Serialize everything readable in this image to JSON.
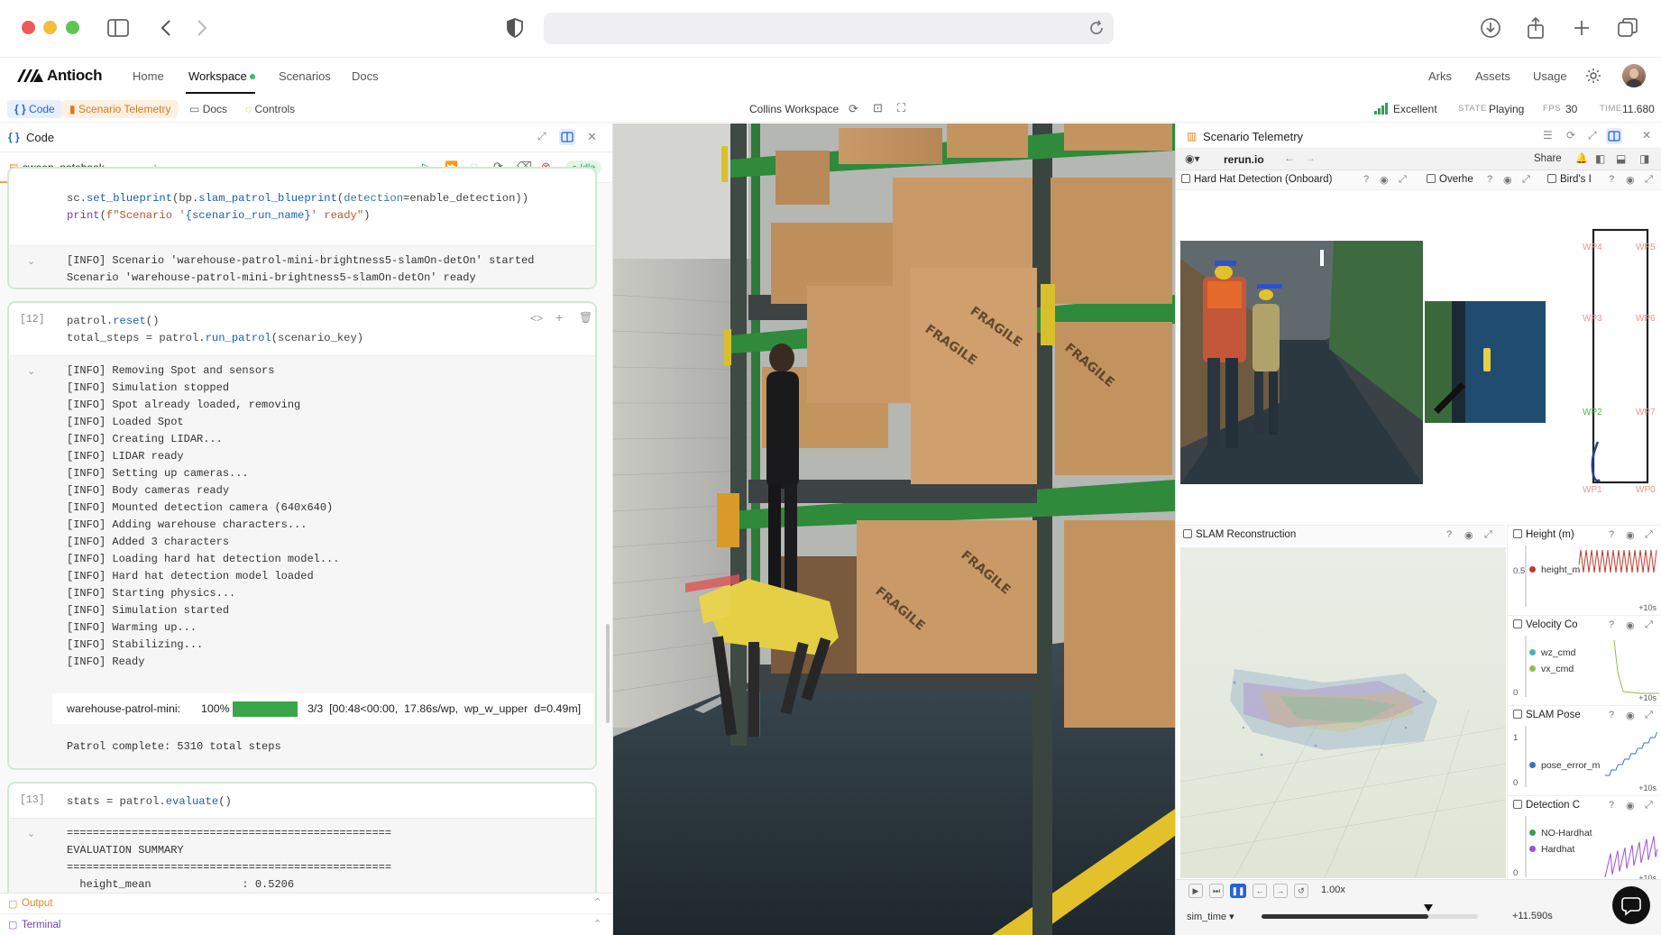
{
  "app": {
    "brand": "Antioch",
    "nav": [
      "Home",
      "Workspace",
      "Scenarios",
      "Docs"
    ],
    "nav_right": [
      "Arks",
      "Assets",
      "Usage"
    ]
  },
  "toolbar": {
    "tabs": [
      "Code",
      "Scenario Telemetry",
      "Docs",
      "Controls"
    ],
    "workspace_name": "Collins Workspace",
    "quality": "Excellent",
    "state_label": "STATE",
    "state_value": "Playing",
    "fps_label": "FPS",
    "fps_value": "30",
    "time_label": "TIME",
    "time_value": "11.680"
  },
  "code_panel": {
    "title": "Code",
    "file_tab": "sweep_notebook....",
    "kernel_status": "Idle",
    "cell_a": {
      "lines": [
        "sc.set_blueprint(bp.slam_patrol_blueprint(detection=enable_detection))",
        "print(f\"Scenario '{scenario_run_name}' ready\")"
      ],
      "output": [
        "[INFO] Scenario 'warehouse-patrol-mini-brightness5-slamOn-detOn' started",
        "Scenario 'warehouse-patrol-mini-brightness5-slamOn-detOn' ready"
      ]
    },
    "cell_12": {
      "number": "[12]",
      "lines": [
        "patrol.reset()",
        "total_steps = patrol.run_patrol(scenario_key)"
      ],
      "output": [
        "[INFO] Removing Spot and sensors",
        "[INFO] Simulation stopped",
        "[INFO] Spot already loaded, removing",
        "[INFO] Loaded Spot",
        "[INFO] Creating LIDAR...",
        "[INFO] LIDAR ready",
        "[INFO] Setting up cameras...",
        "[INFO] Body cameras ready",
        "[INFO] Mounted detection camera (640x640)",
        "[INFO] Adding warehouse characters...",
        "[INFO] Added 3 characters",
        "[INFO] Loading hard hat detection model...",
        "[INFO] Hard hat detection model loaded",
        "[INFO] Starting physics...",
        "[INFO] Simulation started",
        "[INFO] Warming up...",
        "[INFO] Stabilizing...",
        "[INFO] Ready"
      ],
      "progress": {
        "name": "warehouse-patrol-mini:",
        "percent_text": "100%",
        "fraction": 1.0,
        "detail": "3/3  [00:48<00:00,  17.86s/wp,  wp_w_upper  d=0.49m]"
      },
      "complete": "Patrol complete: 5310 total steps"
    },
    "cell_13": {
      "number": "[13]",
      "lines": [
        "stats = patrol.evaluate()"
      ],
      "output": [
        "==================================================",
        "EVALUATION SUMMARY",
        "==================================================",
        "  height_mean              : 0.5206"
      ]
    },
    "bottom": [
      "Output",
      "Terminal"
    ]
  },
  "telemetry": {
    "title": "Scenario Telemetry",
    "source": "rerun.io",
    "share": "Share",
    "views": {
      "hardhat": "Hard Hat Detection (Onboard)",
      "overhead": "Overhe",
      "birds": "Bird's I",
      "slam": "SLAM Reconstruction"
    },
    "waypoints": [
      "WP4",
      "WP5",
      "WP3",
      "WP6",
      "WP2",
      "WP7",
      "WP1",
      "WP0"
    ],
    "plots": [
      {
        "title": "Height (m)",
        "y_tick": "0.5",
        "legend": [
          "height_m"
        ],
        "x_label": "+10s"
      },
      {
        "title": "Velocity Co",
        "y_tick": "0",
        "legend": [
          "wz_cmd",
          "vx_cmd"
        ],
        "x_label": "+10s"
      },
      {
        "title": "SLAM Pose",
        "y_tick_top": "1",
        "y_tick": "0",
        "legend": [
          "pose_error_m"
        ],
        "x_label": "+10s"
      },
      {
        "title": "Detection C",
        "y_tick": "0",
        "legend": [
          "NO-Hardhat",
          "Hardhat"
        ],
        "x_label": "+10s"
      }
    ],
    "playback": {
      "speed": "1.00x",
      "timeline": "sim_time",
      "time_offset": "+11.590s",
      "position_fraction": 0.77
    },
    "colors": {
      "wz_cmd": "#4bb3b0",
      "vx_cmd": "#8cbf4a",
      "pose_error_m": "#3d6fc4",
      "no_hardhat": "#3d9b5e",
      "hardhat": "#a04fd0",
      "height_m": "#c0392b"
    }
  }
}
